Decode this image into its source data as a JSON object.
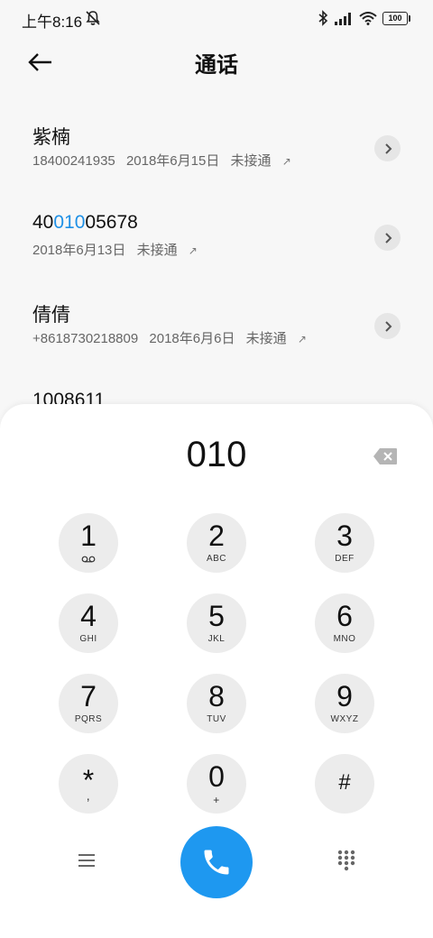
{
  "status_bar": {
    "time": "上午8:16",
    "battery": "100"
  },
  "header": {
    "title": "通话"
  },
  "calls": [
    {
      "name": "紫楠",
      "number": "18400241935",
      "date": "2018年6月15日",
      "status": "未接通"
    },
    {
      "name_prefix": "40",
      "name_highlight": "010",
      "name_suffix": "05678",
      "date": "2018年6月13日",
      "status": "未接通"
    },
    {
      "name": "倩倩",
      "number": "+8618730218809",
      "date": "2018年6月6日",
      "status": "未接通"
    },
    {
      "name": "1008611"
    }
  ],
  "dialpad": {
    "number": "010",
    "keys": [
      {
        "digit": "1",
        "letters": ""
      },
      {
        "digit": "2",
        "letters": "ABC"
      },
      {
        "digit": "3",
        "letters": "DEF"
      },
      {
        "digit": "4",
        "letters": "GHI"
      },
      {
        "digit": "5",
        "letters": "JKL"
      },
      {
        "digit": "6",
        "letters": "MNO"
      },
      {
        "digit": "7",
        "letters": "PQRS"
      },
      {
        "digit": "8",
        "letters": "TUV"
      },
      {
        "digit": "9",
        "letters": "WXYZ"
      },
      {
        "digit": "*",
        "letters": ","
      },
      {
        "digit": "0",
        "letters": "+"
      },
      {
        "digit": "#",
        "letters": ""
      }
    ]
  },
  "colors": {
    "accent": "#1e98f0",
    "highlight": "#1e90e6",
    "key_bg": "#ececec"
  }
}
